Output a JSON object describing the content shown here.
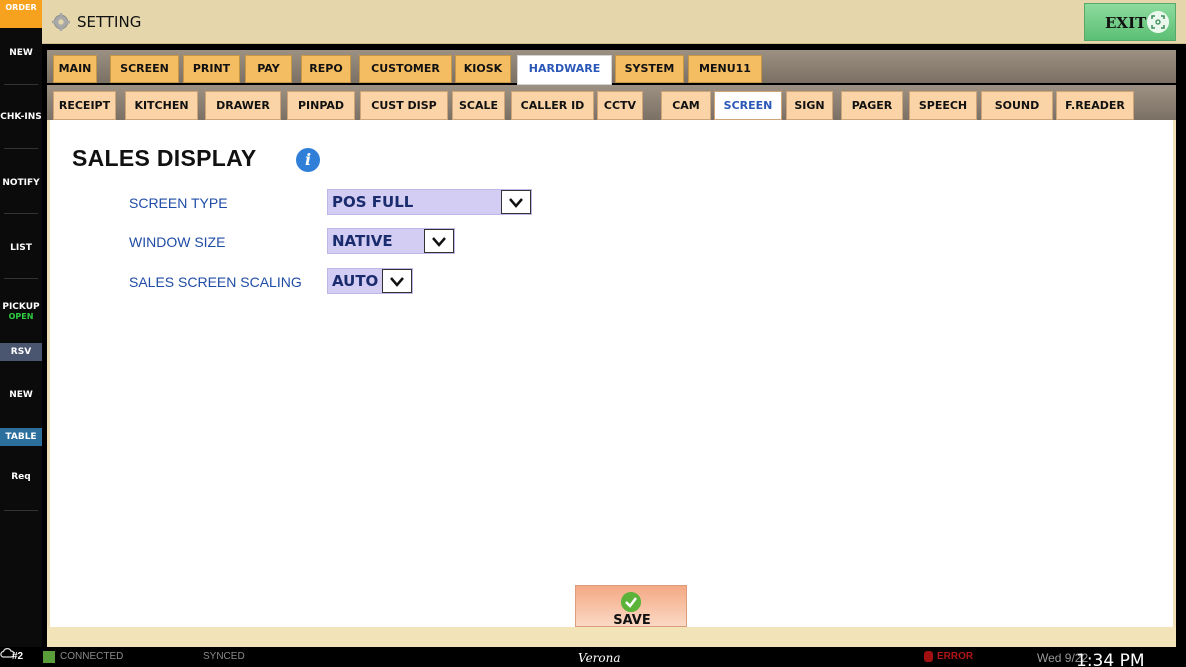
{
  "sidebar": {
    "items": [
      {
        "label": "ORDER"
      },
      {
        "label": "NEW"
      },
      {
        "label": "CHK-INS"
      },
      {
        "label": "NOTIFY"
      },
      {
        "label": "LIST"
      },
      {
        "label": "PICKUP",
        "sub": "OPEN"
      },
      {
        "label": "RSV"
      },
      {
        "label": "NEW"
      },
      {
        "label": "TABLE"
      },
      {
        "label": "Req"
      }
    ]
  },
  "header": {
    "title": "SETTING",
    "exit_label": "EXIT"
  },
  "tabs_primary": [
    "MAIN",
    "SCREEN",
    "PRINT",
    "PAY",
    "REPO",
    "CUSTOMER",
    "KIOSK",
    "HARDWARE",
    "SYSTEM",
    "MENU11"
  ],
  "tabs_primary_active": "HARDWARE",
  "tabs_secondary": [
    "RECEIPT",
    "KITCHEN",
    "DRAWER",
    "PINPAD",
    "CUST DISP",
    "SCALE",
    "CALLER ID",
    "CCTV",
    "CAM",
    "SCREEN",
    "SIGN",
    "PAGER",
    "SPEECH",
    "SOUND",
    "F.READER"
  ],
  "tabs_secondary_active": "SCREEN",
  "main": {
    "title": "SALES DISPLAY",
    "fields": [
      {
        "label": "SCREEN TYPE",
        "value": "POS FULL"
      },
      {
        "label": "WINDOW SIZE",
        "value": "NATIVE"
      },
      {
        "label": "SALES SCREEN SCALING",
        "value": "AUTO"
      }
    ],
    "save_label": "SAVE"
  },
  "status": {
    "station": "#2",
    "connection": "CONNECTED",
    "sync": "SYNCED",
    "venue": "Verona",
    "error": "ERROR",
    "date": "Wed 9/22",
    "time": "1:34 PM"
  },
  "colors": {
    "tab_primary": "#f5bd62",
    "tab_secondary": "#fad3a6",
    "active_tab_text": "#2b58b8",
    "dropdown_bg": "#d3cdf3",
    "label_blue": "#1f4ca6",
    "exit_green": "#5cbf74"
  }
}
